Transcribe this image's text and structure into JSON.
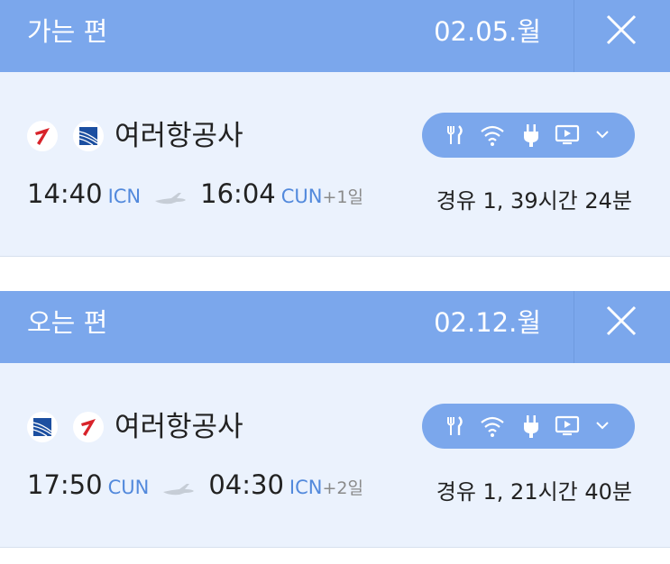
{
  "outbound": {
    "label": "가는 편",
    "date": "02.05.월",
    "airline": "여러항공사",
    "depart_time": "14:40",
    "depart_code": "ICN",
    "arrive_time": "16:04",
    "arrive_code": "CUN",
    "day_offset": "+1일",
    "duration": "경유 1, 39시간 24분",
    "logos": [
      "asiana-logo",
      "united-logo"
    ]
  },
  "inbound": {
    "label": "오는 편",
    "date": "02.12.월",
    "airline": "여러항공사",
    "depart_time": "17:50",
    "depart_code": "CUN",
    "arrive_time": "04:30",
    "arrive_code": "ICN",
    "day_offset": "+2일",
    "duration": "경유 1, 21시간 40분",
    "logos": [
      "united-logo",
      "asiana-logo"
    ]
  },
  "amenities": [
    "meal-icon",
    "wifi-icon",
    "power-icon",
    "tv-icon",
    "chevron-down-icon"
  ],
  "colors": {
    "header": "#7ba7ec",
    "card_bg": "#ebf2fd",
    "code_blue": "#5289dc",
    "asiana_red": "#d8232a",
    "united_blue": "#1c4fa0"
  }
}
